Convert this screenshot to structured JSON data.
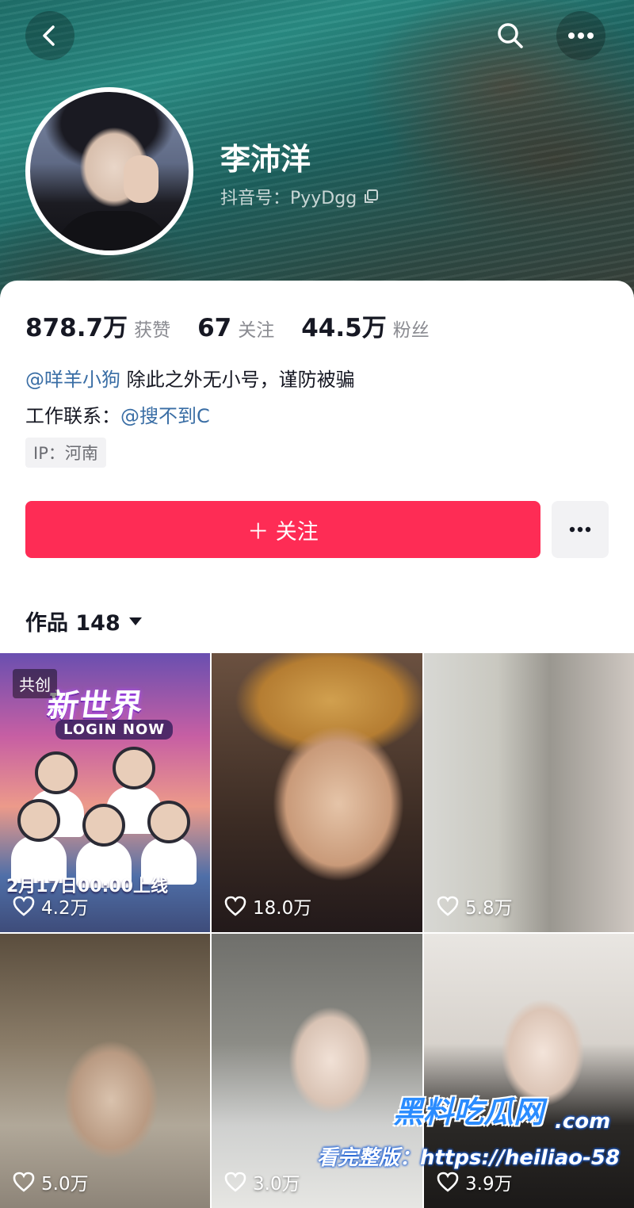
{
  "profile": {
    "name": "李沛洋",
    "douyin_id": "抖音号：PyyDgg",
    "stats": [
      {
        "value": "878.7万",
        "label": "获赞"
      },
      {
        "value": "67",
        "label": "关注"
      },
      {
        "value": "44.5万",
        "label": "粉丝"
      }
    ],
    "bio": {
      "line1_mention": "@咩羊小狗",
      "line1_text": " 除此之外无小号，谨防被骗",
      "line2_text": "工作联系：",
      "line2_mention": "@搜不到C"
    },
    "ip_tag": "IP：河南",
    "follow_label": "＋ 关注"
  },
  "works": {
    "tab_label": "作品 148",
    "items": [
      {
        "likes": "4.2万",
        "badge": "共创",
        "poster_title": "新世界",
        "poster_sub": "LOGIN NOW",
        "poster_date": "2月17日00:00上线"
      },
      {
        "likes": "18.0万"
      },
      {
        "likes": "5.8万"
      },
      {
        "likes": "5.0万"
      },
      {
        "likes": "3.0万"
      },
      {
        "likes": "3.9万"
      }
    ]
  },
  "watermark": {
    "brand": "黑料吃瓜网",
    "domain": ".com",
    "url": "看完整版：https://heiliao-58"
  },
  "colors": {
    "accent": "#fe2c55",
    "mention": "#3a6ea5"
  },
  "icons": [
    "back-arrow-icon",
    "search-icon",
    "more-icon",
    "copy-icon",
    "caret-down-icon",
    "heart-icon"
  ]
}
